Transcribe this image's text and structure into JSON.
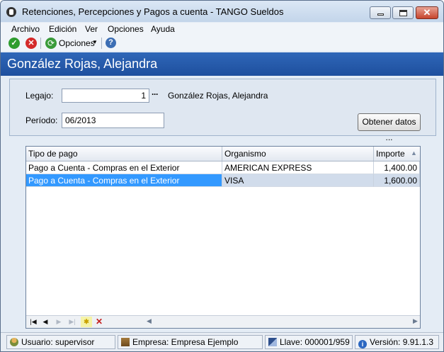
{
  "window": {
    "title": "Retenciones, Percepciones y Pagos a cuenta - TANGO Sueldos"
  },
  "menu": [
    "Archivo",
    "Edición",
    "Ver",
    "Opciones",
    "Ayuda"
  ],
  "toolbar": {
    "options_label": "Opciones"
  },
  "header": {
    "employee_name": "González Rojas, Alejandra"
  },
  "form": {
    "legajo_label": "Legajo:",
    "legajo_value": "1",
    "legajo_name": "González Rojas, Alejandra",
    "periodo_label": "Período:",
    "periodo_value": "06/2013",
    "obtener_button": "Obtener datos ..."
  },
  "grid": {
    "columns": [
      "Tipo de pago",
      "Organismo",
      "Importe"
    ],
    "rows": [
      {
        "tipo": "Pago a Cuenta - Compras en el Exterior",
        "organismo": "AMERICAN EXPRESS",
        "importe": "1,400.00"
      },
      {
        "tipo": "Pago a Cuenta - Compras en el Exterior",
        "organismo": "VISA",
        "importe": "1,600.00"
      }
    ]
  },
  "status": {
    "usuario": "Usuario: supervisor",
    "empresa": "Empresa: Empresa Ejemplo",
    "llave": "Llave: 000001/959",
    "version": "Versión: 9.91.1.3"
  }
}
